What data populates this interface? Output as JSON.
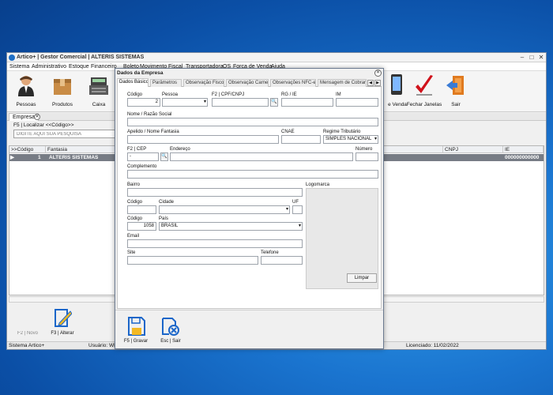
{
  "app": {
    "title": "Artico+ | Gestor Comercial | ALTERIS SISTEMAS",
    "window_controls": [
      "–",
      "□",
      "✕"
    ],
    "menu": [
      "Sistema",
      "Administrativo",
      "Estoque",
      "Financeiro",
      "Boleto",
      "Movimento",
      "Fiscal",
      "Transportadora",
      "OS",
      "Força de Venda",
      "Ajuda"
    ],
    "toolbar": [
      {
        "label": "Pessoas",
        "icon": "person-icon"
      },
      {
        "label": "Produtos",
        "icon": "box-icon"
      },
      {
        "label": "Caixa",
        "icon": "cash-register-icon"
      },
      {
        "label": "e Venda",
        "icon": "phone-icon"
      },
      {
        "label": "Fechar Janelas",
        "icon": "checkmark-icon"
      },
      {
        "label": "Sair",
        "icon": "exit-door-icon"
      }
    ]
  },
  "tab": {
    "label": "Empresa",
    "close": "✕"
  },
  "search": {
    "label": "F5 | Localizar <<Código>>",
    "placeholder": "DIGITE AQUI SUA PESQUISA"
  },
  "grid": {
    "columns": [
      ">>Código",
      "Fantasia",
      "CNPJ",
      "IE"
    ],
    "rows": [
      {
        "codigo": "1",
        "fantasia": "ALTERIS SISTEMAS",
        "ie": "000000000000"
      }
    ]
  },
  "bottom_tools": [
    {
      "label": "F2 | Novo"
    },
    {
      "label": "F3 | Alterar"
    }
  ],
  "status": {
    "left": "Sistema Artico+",
    "user": "Usuário: WEB",
    "license": "Licenciado: 11/02/2022"
  },
  "dialog": {
    "title": "Dados da Empresa",
    "close": "✕",
    "tabs": [
      "Dados Básico",
      "Parâmetros",
      "Observação Fisco",
      "Observação Carne",
      "Observações NFC-e",
      "Mensagem de Cobrança"
    ],
    "nav": [
      "◀",
      "▶"
    ],
    "fields": {
      "codigo_label": "Código",
      "codigo_value": "2",
      "pessoa_label": "Pessoa",
      "pessoa_value": "",
      "cpf_label": "F2 | CPF/CNPJ",
      "rg_label": "RG / IE",
      "im_label": "IM",
      "razao_label": "Nome / Razão Social",
      "apelido_label": "Apelido / Nome Fantasia",
      "cnae_label": "CNAE",
      "regime_label": "Regime Tributário",
      "regime_value": "SIMPLES NACIONAL",
      "cep_label": "F2 | CEP",
      "cep_value": "  -  ",
      "endereco_label": "Endereço",
      "numero_label": "Número",
      "complemento_label": "Complemento",
      "bairro_label": "Bairro",
      "logomarca_label": "Logomarca",
      "codigo_cidade_label": "Código",
      "cidade_label": "Cidade",
      "uf_label": "UF",
      "codigo_pais_label": "Código",
      "codigo_pais_value": "1058",
      "pais_label": "País",
      "pais_value": "BRASIL",
      "email_label": "Email",
      "site_label": "Site",
      "telefone_label": "Telefone",
      "limpar": "Limpar"
    },
    "buttons": [
      {
        "label": "F5 | Gravar",
        "icon": "floppy-disk-icon"
      },
      {
        "label": "Esc | Sair",
        "icon": "cancel-icon"
      }
    ]
  }
}
